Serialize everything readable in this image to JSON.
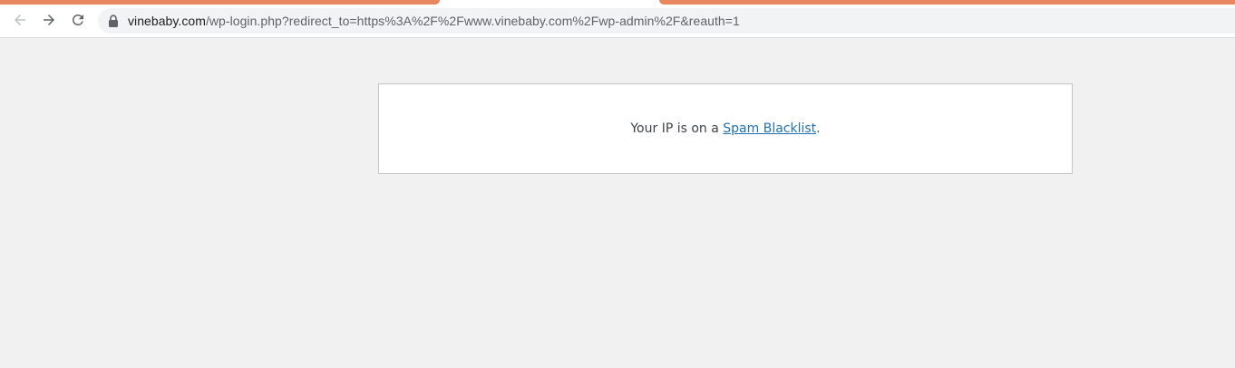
{
  "browser": {
    "url_host": "vinebaby.com",
    "url_path": "/wp-login.php?redirect_to=https%3A%2F%2Fwww.vinebaby.com%2Fwp-admin%2F&reauth=1",
    "icons": {
      "back": "arrow-left-icon",
      "forward": "arrow-right-icon",
      "reload": "reload-icon",
      "lock": "lock-icon"
    },
    "tab_accent": "#e8875f"
  },
  "page": {
    "message_prefix": "Your IP is on a ",
    "link_text": "Spam Blacklist",
    "message_suffix": ".",
    "link_color": "#2271b1"
  }
}
